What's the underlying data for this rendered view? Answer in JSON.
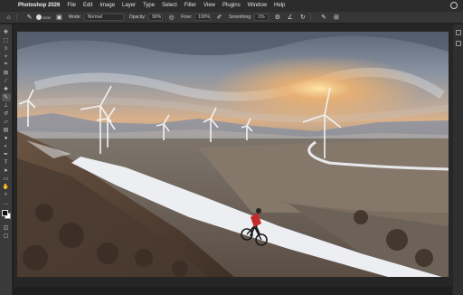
{
  "menubar": {
    "app_name": "Photoshop 2026",
    "items": [
      "File",
      "Edit",
      "Image",
      "Layer",
      "Type",
      "Select",
      "Filter",
      "View",
      "Plugins",
      "Window",
      "Help"
    ]
  },
  "options": {
    "brush_size": "1000",
    "mode_label": "Mode:",
    "mode_value": "Normal",
    "opacity_label": "Opacity:",
    "opacity_value": "90%",
    "flow_label": "Flow:",
    "flow_value": "100%",
    "smoothing_label": "Smoothing:",
    "smoothing_value": "1%"
  },
  "colors": {
    "ui_dark": "#1e1e1e",
    "toolbar": "#3a3a3a",
    "menubar": "#2c2c2c",
    "cyclist_jacket": "#c62a2a"
  },
  "tools": [
    "move-icon",
    "marquee-icon",
    "lasso-icon",
    "magic-wand-icon",
    "crop-icon",
    "frame-icon",
    "eyedropper-icon",
    "healing-icon",
    "brush-icon",
    "clone-stamp-icon",
    "history-brush-icon",
    "eraser-icon",
    "gradient-icon",
    "blur-icon",
    "dodge-icon",
    "pen-icon",
    "type-icon",
    "path-select-icon",
    "shape-icon",
    "hand-icon",
    "zoom-icon",
    "more-tools-icon"
  ]
}
